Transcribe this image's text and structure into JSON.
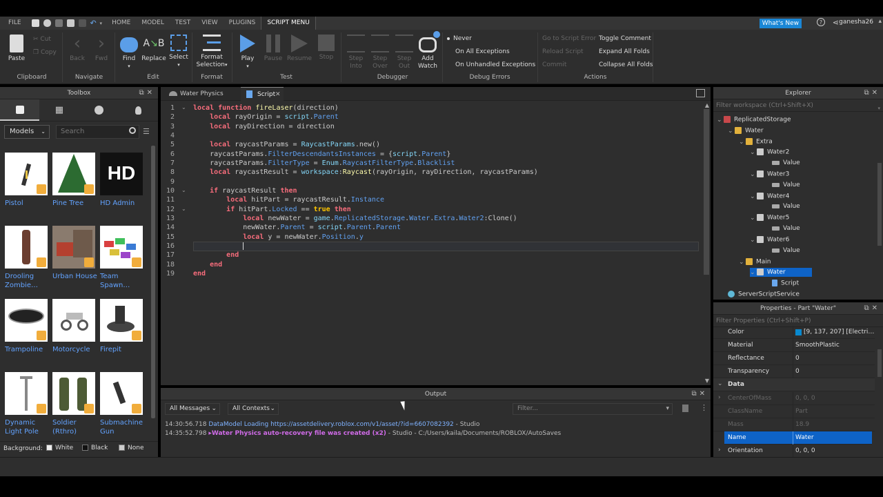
{
  "ribbon": {
    "file_tab": "FILE",
    "tabs": [
      "HOME",
      "MODEL",
      "TEST",
      "VIEW",
      "PLUGINS",
      "SCRIPT MENU"
    ],
    "whats_new": "What's New",
    "username": "ganesha26",
    "clipboard": {
      "paste": "Paste",
      "cut": "Cut",
      "copy": "Copy",
      "label": "Clipboard"
    },
    "navigate": {
      "back": "Back",
      "fwd": "Fwd",
      "label": "Navigate"
    },
    "edit": {
      "find": "Find",
      "replace": "Replace",
      "select": "Select",
      "label": "Edit"
    },
    "format": {
      "format_selection_1": "Format",
      "format_selection_2": "Selection",
      "label": "Format"
    },
    "test": {
      "play": "Play",
      "pause": "Pause",
      "resume": "Resume",
      "stop": "Stop",
      "label": "Test"
    },
    "debugger": {
      "step_into_1": "Step",
      "step_into_2": "Into",
      "step_over_1": "Step",
      "step_over_2": "Over",
      "step_out_1": "Step",
      "step_out_2": "Out",
      "add_watch_1": "Add",
      "add_watch_2": "Watch",
      "label": "Debugger"
    },
    "debug_errors": {
      "never": "Never",
      "all": "On All Exceptions",
      "unhandled": "On Unhandled Exceptions",
      "label": "Debug Errors"
    },
    "actions": {
      "goto_error": "Go to Script Error",
      "reload": "Reload Script",
      "commit": "Commit",
      "toggle_comment": "Toggle Comment",
      "expand_folds": "Expand All Folds",
      "collapse_folds": "Collapse All Folds",
      "label": "Actions"
    }
  },
  "toolbox": {
    "title": "Toolbox",
    "category": "Models",
    "search_placeholder": "Search",
    "assets": [
      {
        "name": "Pistol"
      },
      {
        "name": "Pine Tree"
      },
      {
        "name": "HD Admin",
        "logo_text": "HD"
      },
      {
        "name": "Drooling Zombie…"
      },
      {
        "name": "Urban House"
      },
      {
        "name": "Team Spawn…"
      },
      {
        "name": "Trampoline"
      },
      {
        "name": "Motorcycle"
      },
      {
        "name": "Firepit"
      },
      {
        "name": "Dynamic Light Pole"
      },
      {
        "name": "Soldier (Rthro)"
      },
      {
        "name": "Submachine Gun"
      }
    ],
    "background_label": "Background:",
    "bg_white": "White",
    "bg_black": "Black",
    "bg_none": "None"
  },
  "editor": {
    "tabs": [
      {
        "label": "Water Physics"
      },
      {
        "label": "Script"
      }
    ],
    "line_numbers": [
      "1",
      "2",
      "3",
      "4",
      "5",
      "6",
      "7",
      "8",
      "9",
      "10",
      "11",
      "12",
      "13",
      "14",
      "15",
      "16",
      "17",
      "18",
      "19"
    ],
    "code": {
      "l1_kw1": "local",
      "l1_kw2": "function",
      "l1_fn": "fireLaser",
      "l1_rest": "(direction)",
      "l2_kw": "local",
      "l2_a": " rayOrigin = ",
      "l2_bi": "script",
      "l2_b": ".",
      "l2_p": "Parent",
      "l3_kw": "local",
      "l3_a": " rayDirection = direction",
      "l5_kw": "local",
      "l5_a": " raycastParams = ",
      "l5_bi": "RaycastParams",
      "l5_b": ".new()",
      "l6_a": "raycastParams.",
      "l6_p": "FilterDescendantsInstances",
      "l6_b": " = {",
      "l6_bi": "script",
      "l6_c": ".",
      "l6_p2": "Parent",
      "l6_d": "}",
      "l7_a": "raycastParams.",
      "l7_p": "FilterType",
      "l7_b": " = ",
      "l7_bi": "Enum",
      "l7_c": ".",
      "l7_p2": "RaycastFilterType",
      "l7_d": ".",
      "l7_p3": "Blacklist",
      "l8_kw": "local",
      "l8_a": " raycastResult = ",
      "l8_bi": "workspace",
      "l8_b": ":",
      "l8_fn": "Raycast",
      "l8_c": "(rayOrigin, rayDirection, raycastParams)",
      "l10_kw": "if",
      "l10_a": " raycastResult ",
      "l10_kw2": "then",
      "l11_kw": "local",
      "l11_a": " hitPart = raycastResult.",
      "l11_p": "Instance",
      "l12_kw": "if",
      "l12_a": " hitPart.",
      "l12_p": "Locked",
      "l12_b": " == ",
      "l12_bool": "true",
      "l12_c": " ",
      "l12_kw2": "then",
      "l13_kw": "local",
      "l13_a": " newWater = ",
      "l13_bi": "game",
      "l13_b": ".",
      "l13_p": "ReplicatedStorage",
      "l13_c": ".",
      "l13_p2": "Water",
      "l13_d": ".",
      "l13_p3": "Extra",
      "l13_e": ".",
      "l13_p4": "Water2",
      "l13_f": ":Clone()",
      "l14_a": "newWater.",
      "l14_p": "Parent",
      "l14_b": " = ",
      "l14_bi": "script",
      "l14_c": ".",
      "l14_p2": "Parent",
      "l14_d": ".",
      "l14_p3": "Parent",
      "l15_kw": "local",
      "l15_a": " y = newWater.",
      "l15_p": "Position",
      "l15_b": ".",
      "l15_p2": "y",
      "l17_kw": "end",
      "l18_kw": "end",
      "l19_kw": "end"
    }
  },
  "output": {
    "title": "Output",
    "messages_filter": "All Messages",
    "contexts_filter": "All Contexts",
    "filter_placeholder": "Filter...",
    "lines": [
      {
        "time": "14:30:56.718",
        "msg": "DataModel Loading https://assetdelivery.roblox.com/v1/asset/?id=6607082392",
        "src": " - Studio"
      },
      {
        "time": "14:35:52.798",
        "msg": "▸Water Physics auto-recovery file was created (x2)",
        "src": " - Studio - C:/Users/kaila/Documents/ROBLOX/AutoSaves"
      }
    ]
  },
  "explorer": {
    "title": "Explorer",
    "filter_placeholder": "Filter workspace (Ctrl+Shift+X)",
    "nodes": [
      "ReplicatedStorage",
      "Water",
      "Extra",
      "Water2",
      "Value",
      "Water3",
      "Value",
      "Water4",
      "Value",
      "Water5",
      "Value",
      "Water6",
      "Value",
      "Main",
      "Water",
      "Script",
      "ServerScriptService"
    ]
  },
  "properties": {
    "title": "Properties - Part \"Water\"",
    "filter_placeholder": "Filter Properties (Ctrl+Shift+P)",
    "color_value": "[9, 137, 207] [Electri…",
    "swatch_color": "#0989cf",
    "rows": [
      {
        "key": "Color",
        "value": "[9, 137, 207] [Electri…"
      },
      {
        "key": "Material",
        "value": "SmoothPlastic"
      },
      {
        "key": "Reflectance",
        "value": "0"
      },
      {
        "key": "Transparency",
        "value": "0"
      },
      {
        "key": "Data",
        "value": ""
      },
      {
        "key": "CenterOfMass",
        "value": "0, 0, 0"
      },
      {
        "key": "ClassName",
        "value": "Part"
      },
      {
        "key": "Mass",
        "value": "18.9"
      },
      {
        "key": "Name",
        "value": "Water"
      },
      {
        "key": "Orientation",
        "value": "0, 0, 0"
      }
    ]
  }
}
